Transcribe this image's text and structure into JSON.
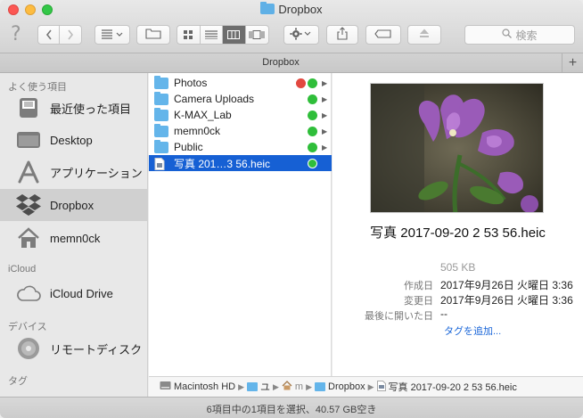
{
  "window": {
    "title": "Dropbox"
  },
  "toolbar": {
    "help_glyph": "?",
    "search_placeholder": "検索",
    "icons": [
      "back-icon",
      "forward-icon",
      "arrange-icon",
      "new-folder-icon",
      "icon-view-icon",
      "list-view-icon",
      "column-view-icon",
      "coverflow-view-icon",
      "gear-icon",
      "share-icon",
      "tag-icon",
      "eject-icon"
    ]
  },
  "tabbar": {
    "label": "Dropbox",
    "add": "+"
  },
  "sidebar": {
    "favorites_header": "よく使う項目",
    "favorites": [
      {
        "label": "最近使った項目",
        "icon": "recents-icon"
      },
      {
        "label": "Desktop",
        "icon": "desktop-icon"
      },
      {
        "label": "アプリケーション",
        "icon": "applications-icon"
      },
      {
        "label": "Dropbox",
        "icon": "dropbox-icon",
        "selected": true
      },
      {
        "label": "memn0ck",
        "icon": "home-icon"
      }
    ],
    "icloud_header": "iCloud",
    "icloud": [
      {
        "label": "iCloud Drive",
        "icon": "cloud-icon"
      }
    ],
    "devices_header": "デバイス",
    "devices": [
      {
        "label": "リモートディスク",
        "icon": "disc-icon"
      }
    ],
    "tags_header": "タグ"
  },
  "files": [
    {
      "name": "Photos",
      "status": [
        "red-dot",
        "sync-ok"
      ],
      "folder": true
    },
    {
      "name": "Camera Uploads",
      "status": [
        "sync-ok"
      ],
      "folder": true
    },
    {
      "name": "K-MAX_Lab",
      "status": [
        "sync-ok"
      ],
      "folder": true
    },
    {
      "name": "memn0ck",
      "status": [
        "sync-ok"
      ],
      "folder": true
    },
    {
      "name": "Public",
      "status": [
        "sync-ok"
      ],
      "folder": true
    },
    {
      "name": "写真 201…3 56.heic",
      "status": [
        "sync-ok"
      ],
      "folder": false,
      "selected": true
    }
  ],
  "preview": {
    "title": "写真 2017-09-20 2 53 56.heic",
    "size": "505 KB",
    "created_label": "作成日",
    "created_value": "2017年9月26日 火曜日 3:36",
    "modified_label": "変更日",
    "modified_value": "2017年9月26日 火曜日 3:36",
    "opened_label": "最後に開いた日",
    "opened_value": "--",
    "add_tags": "タグを追加..."
  },
  "pathbar": {
    "items": [
      "Macintosh HD",
      "ユ",
      "m",
      "Dropbox",
      "写真 2017-09-20 2 53 56.heic"
    ],
    "separator": "▶"
  },
  "statusbar": {
    "text": "6項目中の1項目を選択、40.57 GB空き"
  },
  "colors": {
    "selection": "#1660d4",
    "folder": "#64b5ea",
    "sync_ok": "#2fbe3a",
    "red_dot": "#e2483f",
    "link": "#1a66d8"
  }
}
